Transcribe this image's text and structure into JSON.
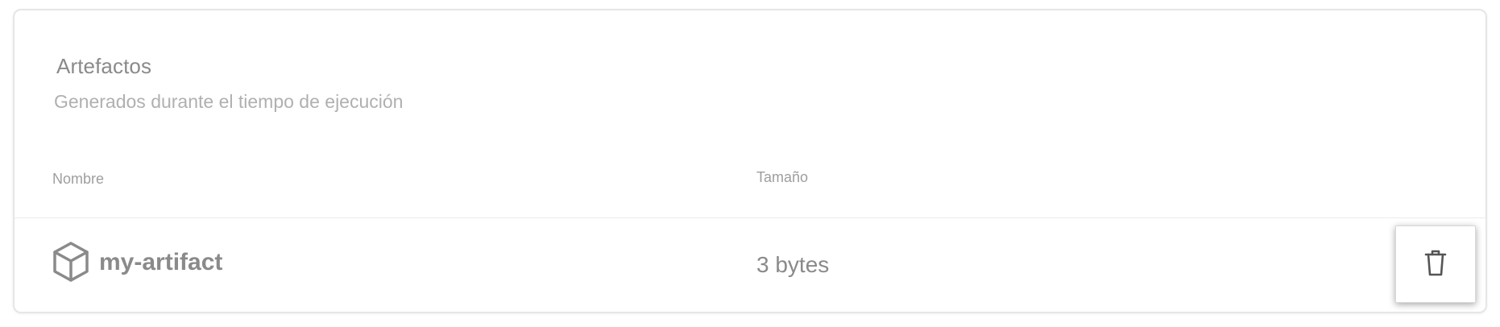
{
  "section": {
    "title": "Artefactos",
    "subtitle": "Generados durante el tiempo de ejecución"
  },
  "table": {
    "columns": [
      "Nombre",
      "Tamaño"
    ],
    "rows": [
      {
        "icon": "package-icon",
        "name": "my-artifact",
        "size": "3 bytes",
        "action_icon": "trash-icon"
      }
    ]
  },
  "colors": {
    "text_primary": "#8a8a8a",
    "text_secondary": "#b0b0b0",
    "border": "#e6e6e6"
  }
}
